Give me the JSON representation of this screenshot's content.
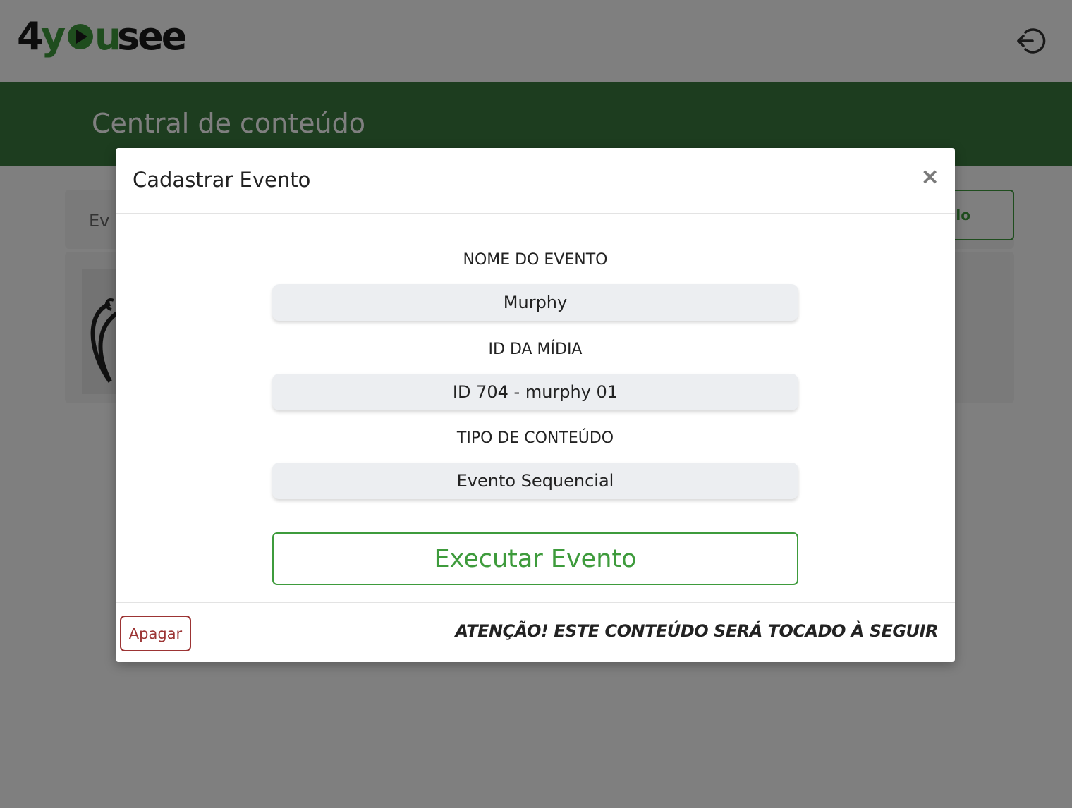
{
  "app": {
    "brand": "4yousee"
  },
  "header": {
    "logout_icon": "logout-icon"
  },
  "banner": {
    "title": "Central de conteúdo"
  },
  "background": {
    "card_label": "Ev",
    "card_button_partial": "lo"
  },
  "modal": {
    "title": "Cadastrar Evento",
    "close_label": "×",
    "fields": [
      {
        "label": "NOME DO EVENTO",
        "value": "Murphy"
      },
      {
        "label": "ID DA MÍDIA",
        "value": "ID 704 - murphy 01"
      },
      {
        "label": "TIPO DE CONTEÚDO",
        "value": "Evento Sequencial"
      }
    ],
    "execute_label": "Executar Evento",
    "delete_label": "Apagar",
    "warning": "ATENÇÃO! ESTE CONTEÚDO SERÁ TOCADO À SEGUIR"
  },
  "colors": {
    "green_accent": "#3e9b3c",
    "banner_green": "#3a7a3f",
    "danger": "#9c3434"
  }
}
